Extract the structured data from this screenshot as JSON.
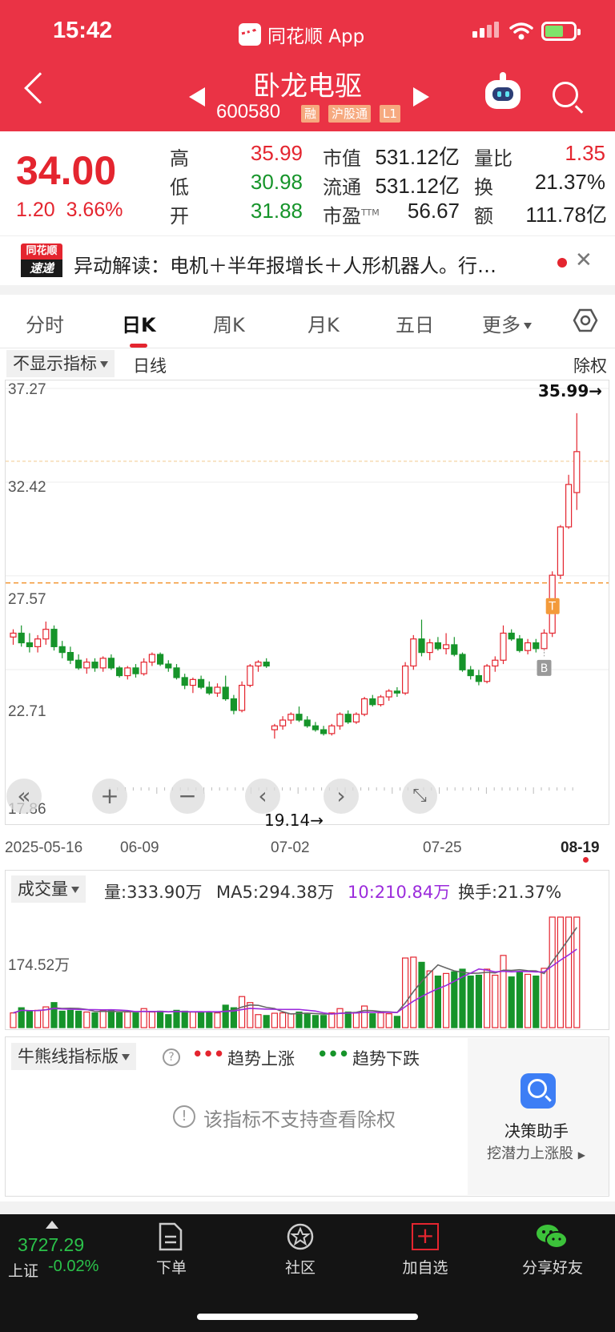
{
  "status_bar": {
    "time": "15:42",
    "app_name": "同花顺 App"
  },
  "nav": {
    "stock_name": "卧龙电驱",
    "stock_code": "600580",
    "tags": [
      "融",
      "沪股通",
      "L1"
    ]
  },
  "quote": {
    "price": "34.00",
    "change": "1.20",
    "change_pct": "3.66%",
    "rows": [
      {
        "k1": "高",
        "v1": "35.99",
        "k2": "市值",
        "v2": "531.12亿",
        "k3": "量比",
        "v3": "1.35"
      },
      {
        "k1": "低",
        "v1": "30.98",
        "k2": "流通",
        "v2": "531.12亿",
        "k3": "换",
        "v3": "21.37%"
      },
      {
        "k1": "开",
        "v1": "31.88",
        "k2": "市盈",
        "k2_sup": "TTM",
        "v2": "56.67",
        "k3": "额",
        "v3": "111.78亿"
      }
    ]
  },
  "news": {
    "logo_top": "同花顺",
    "logo_bottom": "速递",
    "text": "异动解读：电机＋半年报增长＋人形机器人。行…"
  },
  "tabs": [
    {
      "label": "分时"
    },
    {
      "label": "日K"
    },
    {
      "label": "周K"
    },
    {
      "label": "月K"
    },
    {
      "label": "五日"
    },
    {
      "label": "更多"
    }
  ],
  "kline": {
    "indicator_select": "不显示指标",
    "period_label": "日线",
    "adjust_label": "除权",
    "y_ticks": [
      "37.27",
      "32.42",
      "27.57",
      "22.71",
      "17.86"
    ],
    "x_dates": [
      "2025-05-16",
      "06-09",
      "07-02",
      "07-25",
      "08-19"
    ],
    "high_label": "35.99→",
    "low_label": "19.14→",
    "marker_t": "T",
    "marker_b": "B"
  },
  "volume": {
    "select": "成交量",
    "vol": "量:333.90万",
    "ma5": "MA5:294.38万",
    "ma10": "10:210.84万",
    "turnover": "换手:21.37%",
    "y_tick": "174.52万"
  },
  "indicator": {
    "select": "牛熊线指标版",
    "up_dots": "•••",
    "up_label": "趋势上涨",
    "down_dots": "•••",
    "down_label": "趋势下跌",
    "unsupported": "该指标不支持查看除权",
    "assistant_title": "决策助手",
    "assistant_sub": "挖潜力上涨股"
  },
  "bottom_nav": {
    "index_value": "3727.29",
    "index_name": "上证",
    "index_change": "-0.02%",
    "items": [
      {
        "label": "下单"
      },
      {
        "label": "社区"
      },
      {
        "label": "加自选"
      },
      {
        "label": "分享好友"
      }
    ]
  },
  "colors": {
    "header": "#ea3345",
    "up": "#e4252f",
    "down": "#16942a",
    "ma5": "#666666",
    "ma10": "#9b2bdc"
  },
  "chart_data": {
    "type": "candlestick",
    "y_range": [
      17.86,
      37.27
    ],
    "dates": [
      "2025-05-16",
      "06-09",
      "07-02",
      "07-25",
      "08-19"
    ],
    "candles": [
      [
        24.4,
        24.8,
        24.0,
        24.6
      ],
      [
        24.6,
        25.0,
        23.9,
        24.1
      ],
      [
        24.1,
        24.6,
        23.6,
        23.9
      ],
      [
        23.9,
        24.5,
        23.6,
        24.3
      ],
      [
        24.3,
        25.2,
        24.0,
        24.8
      ],
      [
        24.8,
        25.0,
        23.7,
        23.9
      ],
      [
        23.9,
        24.2,
        23.3,
        23.6
      ],
      [
        23.6,
        23.9,
        23.0,
        23.2
      ],
      [
        23.2,
        23.5,
        22.7,
        22.8
      ],
      [
        22.8,
        23.3,
        22.5,
        23.1
      ],
      [
        23.1,
        23.3,
        22.6,
        22.8
      ],
      [
        22.8,
        23.4,
        22.6,
        23.3
      ],
      [
        23.3,
        23.5,
        22.7,
        22.8
      ],
      [
        22.8,
        22.9,
        22.3,
        22.4
      ],
      [
        22.4,
        22.9,
        22.2,
        22.8
      ],
      [
        22.8,
        23.0,
        22.3,
        22.5
      ],
      [
        22.5,
        23.3,
        22.4,
        23.1
      ],
      [
        23.1,
        23.6,
        22.9,
        23.5
      ],
      [
        23.5,
        23.6,
        22.9,
        23.0
      ],
      [
        23.0,
        23.2,
        22.6,
        22.8
      ],
      [
        22.8,
        23.0,
        22.2,
        22.3
      ],
      [
        22.3,
        22.5,
        21.7,
        21.9
      ],
      [
        21.9,
        22.3,
        21.5,
        22.2
      ],
      [
        22.2,
        22.4,
        21.7,
        21.8
      ],
      [
        21.8,
        22.1,
        21.4,
        21.5
      ],
      [
        21.5,
        22.0,
        21.3,
        21.8
      ],
      [
        21.8,
        22.4,
        21.1,
        21.2
      ],
      [
        21.2,
        21.4,
        20.4,
        20.6
      ],
      [
        20.6,
        22.1,
        20.5,
        21.9
      ],
      [
        21.9,
        23.0,
        21.8,
        22.9
      ],
      [
        22.9,
        23.2,
        22.6,
        23.1
      ],
      [
        23.1,
        23.3,
        22.8,
        22.9
      ],
      [
        19.6,
        19.9,
        19.14,
        19.8
      ],
      [
        19.8,
        20.3,
        19.6,
        20.1
      ],
      [
        20.1,
        20.5,
        19.9,
        20.4
      ],
      [
        20.4,
        20.8,
        20.0,
        20.1
      ],
      [
        20.1,
        20.3,
        19.7,
        19.8
      ],
      [
        19.8,
        20.0,
        19.5,
        19.6
      ],
      [
        19.6,
        19.8,
        19.3,
        19.4
      ],
      [
        19.4,
        19.9,
        19.3,
        19.8
      ],
      [
        19.8,
        20.5,
        19.6,
        20.4
      ],
      [
        20.4,
        20.6,
        19.9,
        20.0
      ],
      [
        20.0,
        20.5,
        19.9,
        20.4
      ],
      [
        20.4,
        21.3,
        20.3,
        21.2
      ],
      [
        21.2,
        21.4,
        20.8,
        20.9
      ],
      [
        20.9,
        21.4,
        20.8,
        21.3
      ],
      [
        21.3,
        21.7,
        21.1,
        21.6
      ],
      [
        21.6,
        21.8,
        21.3,
        21.5
      ],
      [
        21.5,
        23.1,
        21.4,
        22.9
      ],
      [
        22.9,
        24.5,
        22.7,
        24.3
      ],
      [
        24.3,
        25.3,
        23.4,
        23.6
      ],
      [
        23.6,
        24.3,
        23.2,
        24.1
      ],
      [
        24.1,
        24.4,
        23.7,
        23.8
      ],
      [
        23.8,
        24.6,
        23.5,
        24.0
      ],
      [
        24.0,
        24.4,
        23.4,
        23.5
      ],
      [
        23.5,
        23.6,
        22.6,
        22.7
      ],
      [
        22.7,
        22.9,
        22.2,
        22.4
      ],
      [
        22.4,
        22.7,
        21.9,
        22.1
      ],
      [
        22.1,
        23.0,
        22.0,
        22.9
      ],
      [
        22.9,
        23.4,
        22.6,
        23.2
      ],
      [
        23.2,
        25.0,
        23.0,
        24.6
      ],
      [
        24.6,
        24.8,
        24.2,
        24.3
      ],
      [
        24.3,
        24.5,
        23.6,
        23.7
      ],
      [
        23.7,
        24.3,
        23.5,
        24.1
      ],
      [
        24.1,
        24.3,
        23.6,
        23.8
      ],
      [
        23.8,
        24.8,
        23.7,
        24.6
      ],
      [
        24.6,
        27.8,
        24.4,
        27.6
      ],
      [
        27.6,
        30.2,
        27.4,
        30.1
      ],
      [
        30.1,
        32.8,
        30.0,
        32.3
      ],
      [
        31.88,
        35.99,
        30.98,
        34.0
      ]
    ],
    "volume_ma": {
      "MA5": "294.38万",
      "MA10": "210.84万"
    }
  }
}
